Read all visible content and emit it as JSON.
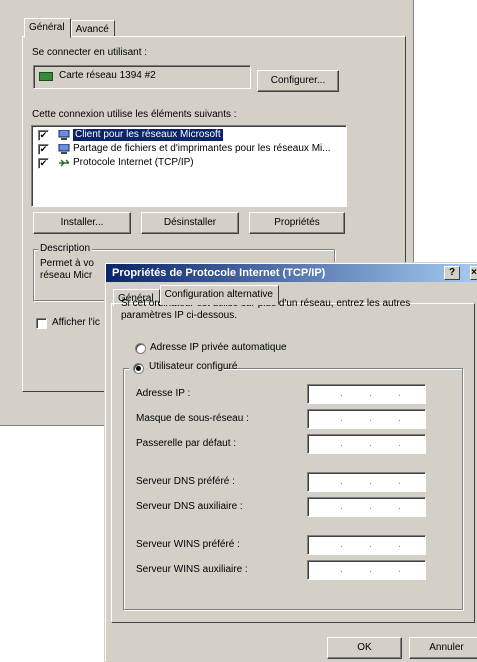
{
  "back_dialog": {
    "tabs": [
      "Général",
      "Avancé"
    ],
    "connect_using_label": "Se connecter en utilisant :",
    "adapter_name": "Carte réseau 1394 #2",
    "configure_button": "Configurer...",
    "components_label": "Cette connexion utilise les éléments suivants :",
    "components": [
      {
        "label": "Client pour les réseaux Microsoft",
        "checked": true,
        "icon": "network-client-icon"
      },
      {
        "label": "Partage de fichiers et d'imprimantes pour les réseaux Mi...",
        "checked": true,
        "icon": "file-printer-sharing-icon"
      },
      {
        "label": "Protocole Internet (TCP/IP)",
        "checked": true,
        "icon": "protocol-icon"
      }
    ],
    "install_button": "Installer...",
    "uninstall_button": "Désinstaller",
    "properties_button": "Propriétés",
    "description_label": "Description",
    "description_text_1": "Permet à vo",
    "description_text_2": "réseau Micr",
    "show_icon_label": "Afficher l'ic"
  },
  "front_dialog": {
    "title": "Propriétés de Protocole Internet (TCP/IP)",
    "help_button": "?",
    "close_button": "×",
    "tabs": [
      "Général",
      "Configuration alternative"
    ],
    "intro_text_1": "Si cet ordinateur est utilisé sur plus d'un réseau, entrez les autres",
    "intro_text_2": "paramètres IP ci-dessous.",
    "radio_auto": "Adresse IP privée automatique",
    "radio_user": "Utilisateur configuré",
    "fields": [
      {
        "label": "Adresse IP :"
      },
      {
        "label": "Masque de sous-réseau :"
      },
      {
        "label": "Passerelle par défaut :"
      },
      {
        "label": "Serveur DNS préféré :"
      },
      {
        "label": "Serveur DNS auxiliaire :"
      },
      {
        "label": "Serveur WINS préféré :"
      },
      {
        "label": "Serveur WINS auxiliaire :"
      }
    ],
    "ip_dot": ".",
    "ok_button": "OK",
    "cancel_button": "Annuler"
  }
}
